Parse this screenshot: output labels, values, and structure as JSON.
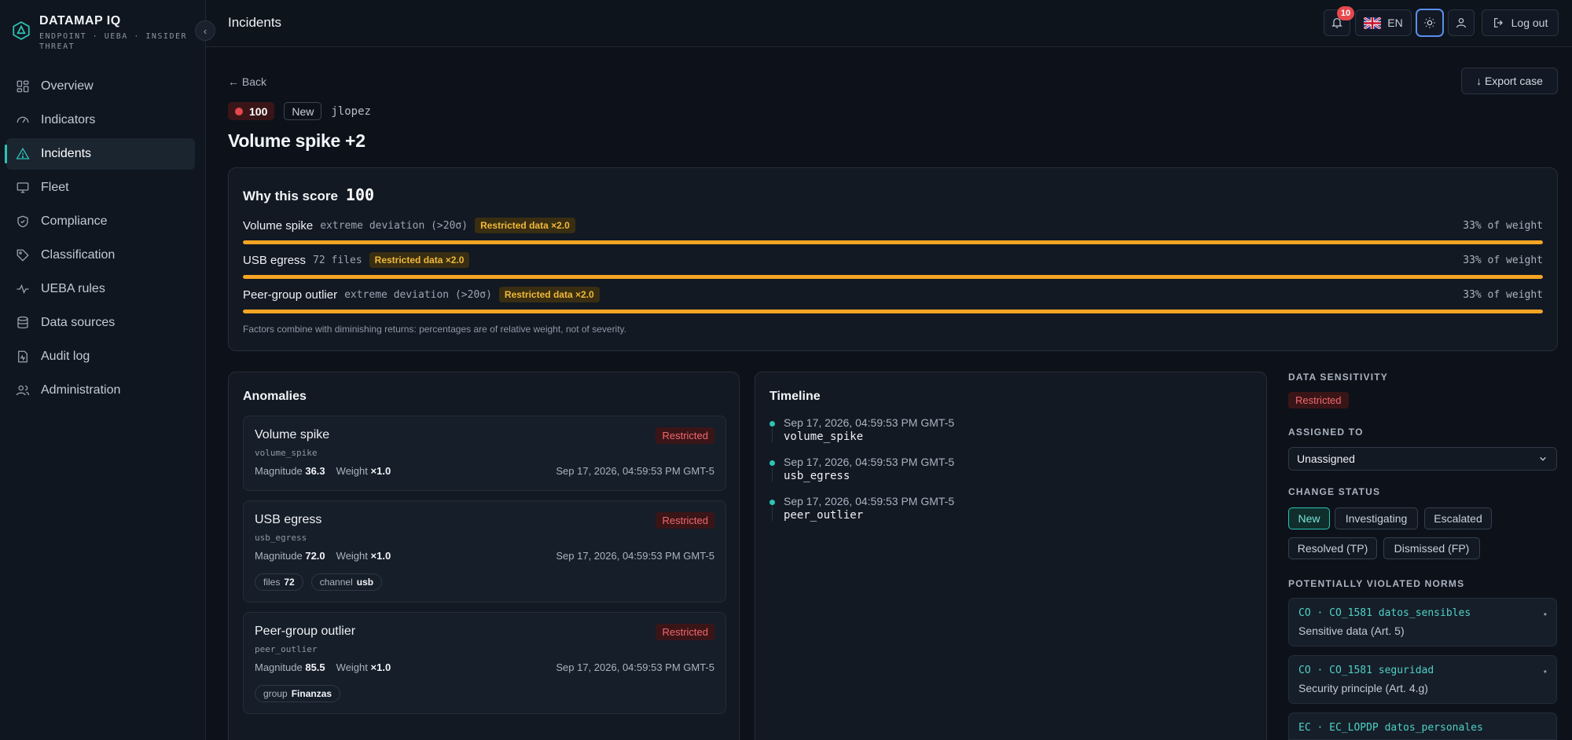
{
  "brand": {
    "name": "DATAMAP IQ",
    "subtitle": "ENDPOINT · UEBA · INSIDER THREAT"
  },
  "sidebar": {
    "items": [
      {
        "label": "Overview",
        "icon": "grid-icon"
      },
      {
        "label": "Indicators",
        "icon": "gauge-icon"
      },
      {
        "label": "Incidents",
        "icon": "warning-icon",
        "active": true
      },
      {
        "label": "Fleet",
        "icon": "monitor-icon"
      },
      {
        "label": "Compliance",
        "icon": "shield-check-icon"
      },
      {
        "label": "Classification",
        "icon": "tag-icon"
      },
      {
        "label": "UEBA rules",
        "icon": "pulse-icon"
      },
      {
        "label": "Data sources",
        "icon": "database-icon"
      },
      {
        "label": "Audit log",
        "icon": "file-pulse-icon"
      },
      {
        "label": "Administration",
        "icon": "users-icon"
      }
    ]
  },
  "topbar": {
    "title": "Incidents",
    "notifications_count": "10",
    "language": "EN",
    "logout_label": "Log out"
  },
  "incident": {
    "back_label": "← Back",
    "export_label": "↓ Export case",
    "score": "100",
    "status": "New",
    "user": "jlopez",
    "title": "Volume spike +2"
  },
  "why_score": {
    "label": "Why this score",
    "value": "100",
    "factors": [
      {
        "name": "Volume spike",
        "detail": "extreme deviation (>20σ)",
        "chip": "Restricted data ×2.0",
        "weight": "33% of weight",
        "fraction": 1.0
      },
      {
        "name": "USB egress",
        "detail": "72 files",
        "chip": "Restricted data ×2.0",
        "weight": "33% of weight",
        "fraction": 1.0
      },
      {
        "name": "Peer-group outlier",
        "detail": "extreme deviation (>20σ)",
        "chip": "Restricted data ×2.0",
        "weight": "33% of weight",
        "fraction": 1.0
      }
    ],
    "footnote": "Factors combine with diminishing returns: percentages are of relative weight, not of severity."
  },
  "anomalies": {
    "title": "Anomalies",
    "items": [
      {
        "name": "Volume spike",
        "code": "volume_spike",
        "chip": "Restricted",
        "magnitude_label": "Magnitude",
        "magnitude": "36.3",
        "weight_label": "Weight",
        "weight": "×1.0",
        "timestamp": "Sep 17, 2026, 04:59:53 PM GMT-5",
        "tags": []
      },
      {
        "name": "USB egress",
        "code": "usb_egress",
        "chip": "Restricted",
        "magnitude_label": "Magnitude",
        "magnitude": "72.0",
        "weight_label": "Weight",
        "weight": "×1.0",
        "timestamp": "Sep 17, 2026, 04:59:53 PM GMT-5",
        "tags": [
          {
            "key": "files",
            "value": "72"
          },
          {
            "key": "channel",
            "value": "usb"
          }
        ]
      },
      {
        "name": "Peer-group outlier",
        "code": "peer_outlier",
        "chip": "Restricted",
        "magnitude_label": "Magnitude",
        "magnitude": "85.5",
        "weight_label": "Weight",
        "weight": "×1.0",
        "timestamp": "Sep 17, 2026, 04:59:53 PM GMT-5",
        "tags": [
          {
            "key": "group",
            "value": "Finanzas"
          }
        ]
      }
    ]
  },
  "timeline": {
    "title": "Timeline",
    "events": [
      {
        "timestamp": "Sep 17, 2026, 04:59:53 PM GMT-5",
        "code": "volume_spike"
      },
      {
        "timestamp": "Sep 17, 2026, 04:59:53 PM GMT-5",
        "code": "usb_egress"
      },
      {
        "timestamp": "Sep 17, 2026, 04:59:53 PM GMT-5",
        "code": "peer_outlier"
      }
    ]
  },
  "panel": {
    "sensitivity_label": "DATA SENSITIVITY",
    "sensitivity_value": "Restricted",
    "assigned_label": "ASSIGNED TO",
    "assigned_value": "Unassigned",
    "status_label": "CHANGE STATUS",
    "statuses": [
      "New",
      "Investigating",
      "Escalated",
      "Resolved (TP)",
      "Dismissed (FP)"
    ],
    "active_status": "New",
    "norms_label": "POTENTIALLY VIOLATED NORMS",
    "norms": [
      {
        "code": "CO · CO_1581 datos_sensibles",
        "desc": "Sensitive data (Art. 5)"
      },
      {
        "code": "CO · CO_1581 seguridad",
        "desc": "Security principle (Art. 4.g)"
      },
      {
        "code": "EC · EC_LOPDP datos_personales",
        "desc": ""
      }
    ]
  },
  "colors": {
    "accent": "#2ec4b6",
    "danger": "#e5484d",
    "warning": "#f5a524",
    "background": "#0d121a"
  }
}
